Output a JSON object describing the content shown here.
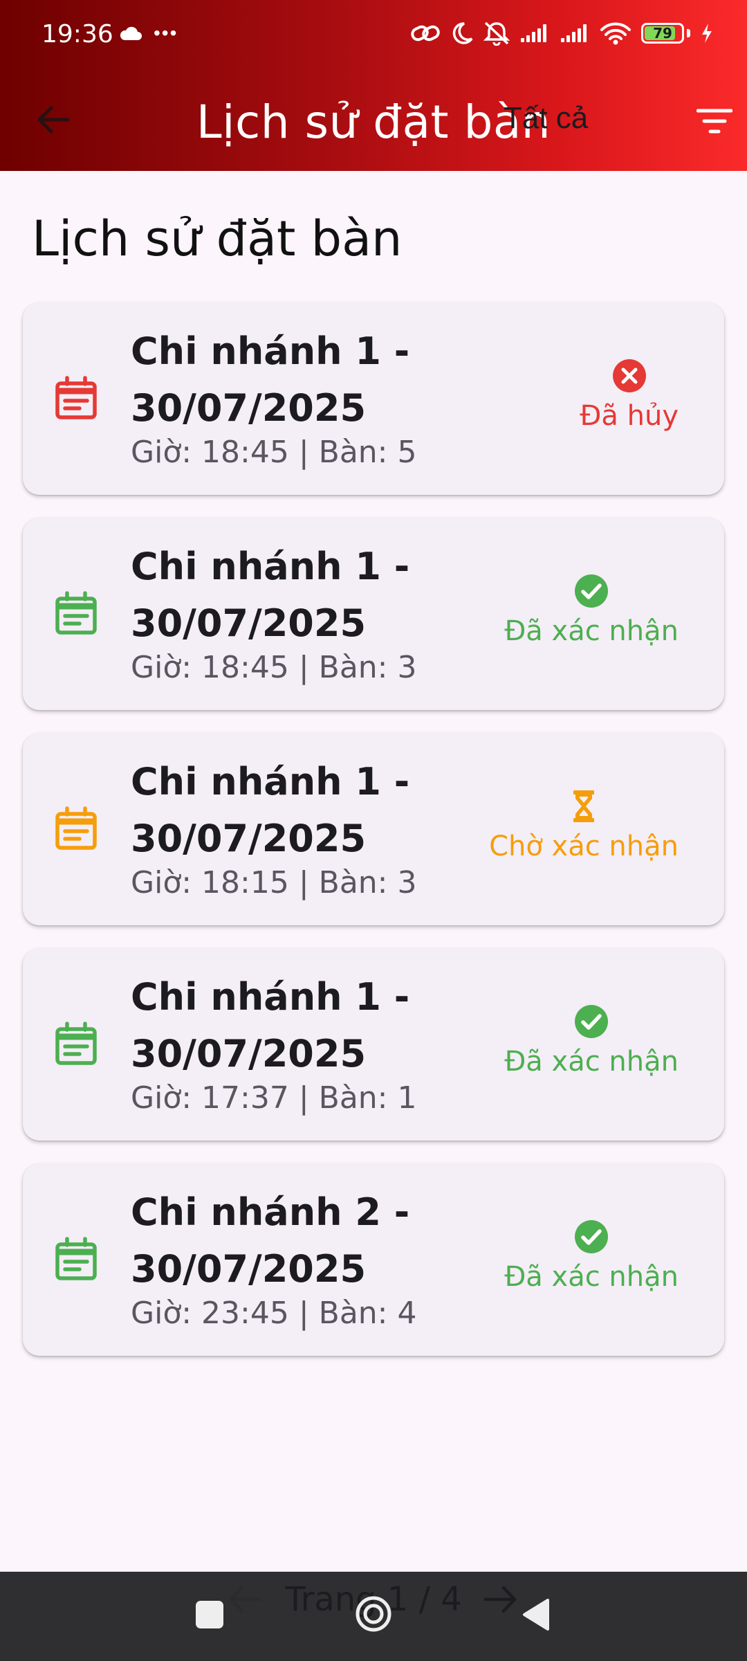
{
  "status_bar": {
    "time": "19:36",
    "more": "•••",
    "battery_level": "79",
    "icons": [
      "cloud-icon",
      "link-icon",
      "moon-icon",
      "bell-off-icon",
      "signal-icon",
      "signal-icon",
      "wifi-icon",
      "battery-icon",
      "charging-icon"
    ]
  },
  "app_bar": {
    "title": "Lịch sử đặt bàn",
    "filter_label": "Tất cả",
    "back_icon": "arrow-left-icon",
    "filter_icon": "filter-icon"
  },
  "page": {
    "heading": "Lịch sử đặt bàn"
  },
  "bookings": [
    {
      "title": "Chi nhánh 1 - 30/07/2025",
      "details": "Giờ: 18:45 | Bàn: 5",
      "status": "Đã hủy",
      "status_type": "cancelled",
      "color": "#E53935"
    },
    {
      "title": "Chi nhánh 1 - 30/07/2025",
      "details": "Giờ: 18:45 | Bàn: 3",
      "status": "Đã xác nhận",
      "status_type": "confirmed",
      "color": "#4CAF50"
    },
    {
      "title": "Chi nhánh 1 - 30/07/2025",
      "details": "Giờ: 18:15 | Bàn: 3",
      "status": "Chờ xác nhận",
      "status_type": "pending",
      "color": "#F59E0B"
    },
    {
      "title": "Chi nhánh 1 - 30/07/2025",
      "details": "Giờ: 17:37 | Bàn: 1",
      "status": "Đã xác nhận",
      "status_type": "confirmed",
      "color": "#4CAF50"
    },
    {
      "title": "Chi nhánh 2 - 30/07/2025",
      "details": "Giờ: 23:45 | Bàn: 4",
      "status": "Đã xác nhận",
      "status_type": "confirmed",
      "color": "#4CAF50"
    }
  ],
  "pagination": {
    "label": "Trang 1 / 4"
  },
  "colors": {
    "header_gradient_start": "#6E0000",
    "header_gradient_end": "#FB2A2A",
    "card_background": "#F4EEF6",
    "page_background": "#FCF5FB",
    "nav_bar": "#2F2F31"
  }
}
